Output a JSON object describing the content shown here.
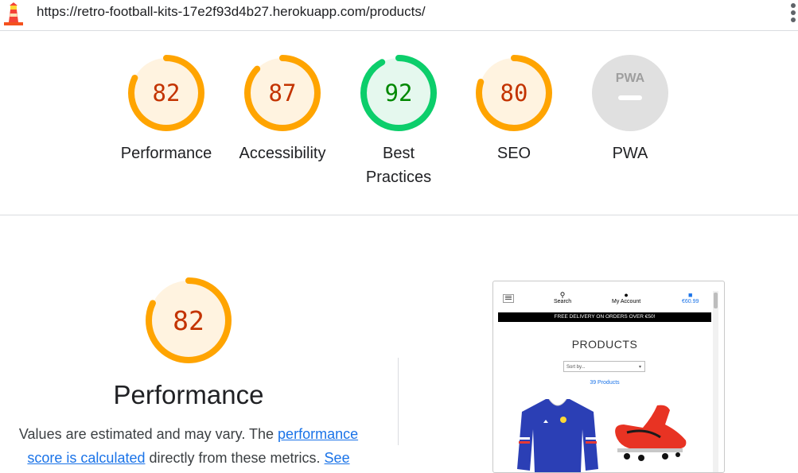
{
  "header": {
    "url": "https://retro-football-kits-17e2f93d4b27.herokuapp.com/products/"
  },
  "colors": {
    "average": "#ffa400",
    "average_text": "#c33300",
    "average_bg": "#fff3e0",
    "pass": "#0cce6b",
    "pass_text": "#008800",
    "pass_bg": "#e5f8ee",
    "na": "#e0e0e0",
    "link": "#1a73e8"
  },
  "scores": [
    {
      "value": "82",
      "fraction": 0.82,
      "label": "Performance",
      "status": "average"
    },
    {
      "value": "87",
      "fraction": 0.87,
      "label": "Accessibility",
      "status": "average"
    },
    {
      "value": "92",
      "fraction": 0.92,
      "label": "Best Practices",
      "label_line1": "Best",
      "label_line2": "Practices",
      "status": "pass"
    },
    {
      "value": "80",
      "fraction": 0.8,
      "label": "SEO",
      "status": "average"
    },
    {
      "value": "",
      "label": "PWA",
      "status": "na",
      "badge_text": "PWA"
    }
  ],
  "performance": {
    "score": "82",
    "fraction": 0.82,
    "title": "Performance",
    "desc_prefix": "Values are estimated and may vary. The ",
    "link_text": "performance score is calculated",
    "desc_mid": " directly from these metrics. ",
    "see_text": "See"
  },
  "thumbnail": {
    "search_label": "Search",
    "account_label": "My Account",
    "cart_total": "€60.99",
    "banner": "FREE DELIVERY ON ORDERS OVER €50!",
    "heading": "PRODUCTS",
    "sort_placeholder": "Sort by...",
    "product_count": "39 Products"
  }
}
